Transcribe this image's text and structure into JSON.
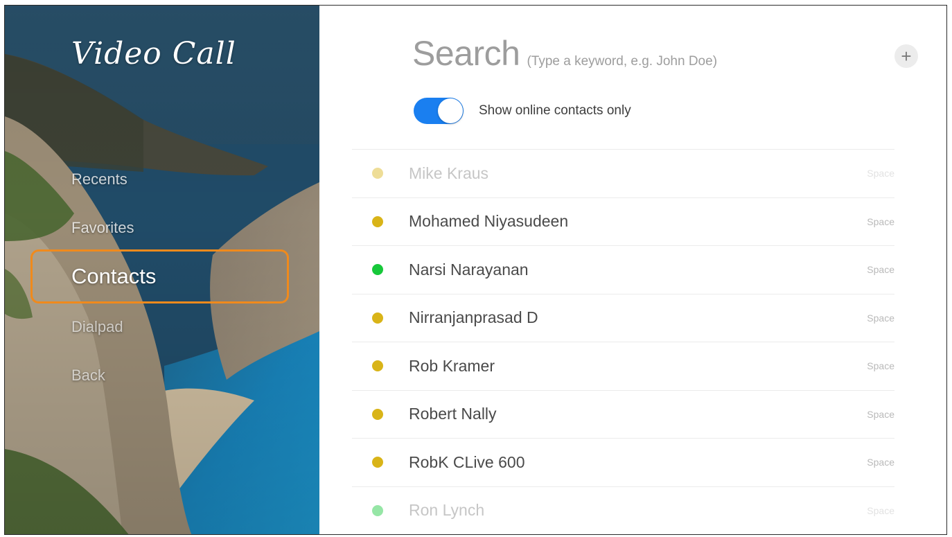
{
  "app": {
    "title": "Video Call"
  },
  "nav": {
    "items": [
      {
        "label": "Recents"
      },
      {
        "label": "Favorites"
      },
      {
        "label": "Contacts",
        "selected": true
      },
      {
        "label": "Dialpad"
      },
      {
        "label": "Back"
      }
    ]
  },
  "search": {
    "label": "Search",
    "hint": "(Type a keyword, e.g. John Doe)"
  },
  "toolbar": {
    "add_icon": "+"
  },
  "filter": {
    "label": "Show online contacts only",
    "enabled": true
  },
  "colors": {
    "accent": "#1a7ff0",
    "focus_ring": "#f08a1c",
    "status_away": "#d9b418",
    "status_online": "#17c83a"
  },
  "contacts": [
    {
      "name": "Mike Kraus",
      "tag": "Space",
      "status": "away"
    },
    {
      "name": "Mohamed Niyasudeen",
      "tag": "Space",
      "status": "away"
    },
    {
      "name": "Narsi Narayanan",
      "tag": "Space",
      "status": "online"
    },
    {
      "name": "Nirranjanprasad D",
      "tag": "Space",
      "status": "away"
    },
    {
      "name": "Rob Kramer",
      "tag": "Space",
      "status": "away"
    },
    {
      "name": "Robert Nally",
      "tag": "Space",
      "status": "away"
    },
    {
      "name": "RobK CLive 600",
      "tag": "Space",
      "status": "away"
    },
    {
      "name": "Ron Lynch",
      "tag": "Space",
      "status": "online"
    }
  ]
}
